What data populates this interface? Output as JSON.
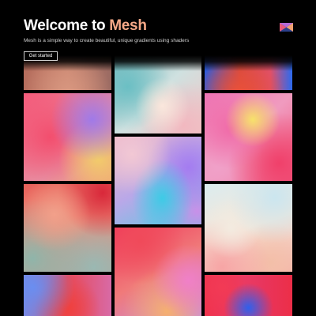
{
  "header": {
    "title_prefix": "Welcome to ",
    "title_accent": "Mesh",
    "subtitle": "Mesh is a simple way to create beautiful, unique gradients using shaders",
    "cta_label": "Get started",
    "logo_icon": "mesh-logo-icon"
  },
  "colors": {
    "background": "#000000",
    "title": "#ffffff",
    "accent": "#f6a887",
    "subtitle": "#cfcfcf"
  },
  "gallery": {
    "tiles": [
      {
        "name": "gradient-tile-1",
        "colors": [
          "#c87a63",
          "#d4907a",
          "#7a5b55"
        ]
      },
      {
        "name": "gradient-tile-2",
        "colors": [
          "#f2466b",
          "#a06ae8",
          "#f08a7a"
        ]
      },
      {
        "name": "gradient-tile-3",
        "colors": [
          "#e23d4a",
          "#f59c86",
          "#8fb3a6"
        ]
      },
      {
        "name": "gradient-tile-4",
        "colors": [
          "#6b8ef2",
          "#f0454a",
          "#d86a9a"
        ]
      },
      {
        "name": "gradient-tile-5",
        "colors": [
          "#6ec2c7",
          "#f3ded6",
          "#f2c4c7"
        ]
      },
      {
        "name": "gradient-tile-6",
        "colors": [
          "#f25a5f",
          "#e0ba7a",
          "#f08a80"
        ]
      },
      {
        "name": "gradient-tile-7",
        "colors": [
          "#f2a3b0",
          "#3dcbe6",
          "#9a7cf0"
        ]
      },
      {
        "name": "gradient-tile-8",
        "colors": [
          "#f2a6b7",
          "#f0d7c8",
          "#b8d0e0"
        ]
      },
      {
        "name": "gradient-tile-9",
        "colors": [
          "#f0345a",
          "#f5a266",
          "#c07ae0"
        ]
      },
      {
        "name": "gradient-tile-10",
        "colors": [
          "#1f63e6",
          "#e84a3a",
          "#f04a7a"
        ]
      },
      {
        "name": "gradient-tile-11",
        "colors": [
          "#f07ab8",
          "#e8d048",
          "#ef4070"
        ]
      },
      {
        "name": "gradient-tile-12",
        "colors": [
          "#cfe7ee",
          "#f3e8de",
          "#f9a6a6"
        ]
      },
      {
        "name": "gradient-tile-13",
        "colors": [
          "#f03a50",
          "#3a64ea",
          "#ec2e48"
        ]
      }
    ]
  }
}
